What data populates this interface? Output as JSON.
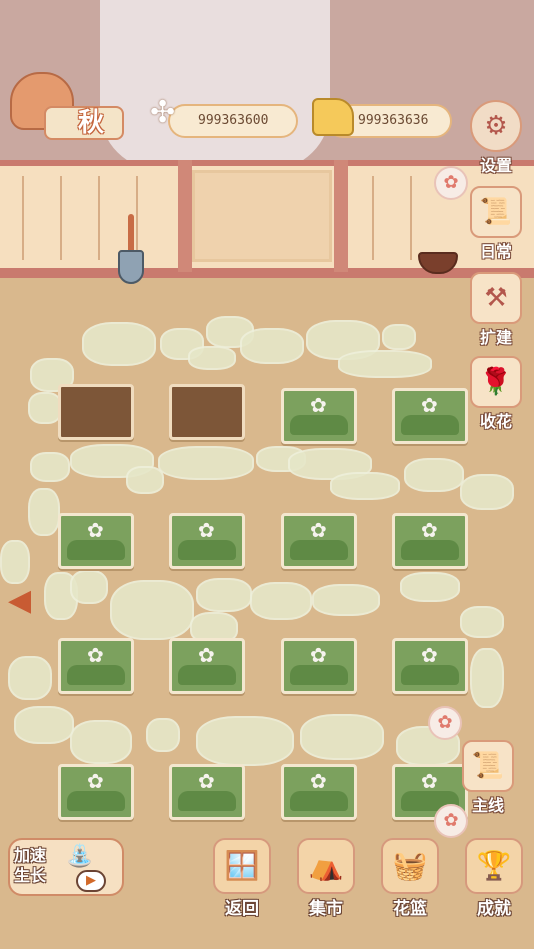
{
  "hud": {
    "season": "秋",
    "season_tree_icon": "autumn-tree-icon",
    "fish_count": "999363600",
    "fish_icon": "fishbone-icon",
    "cheese_count": "999363636",
    "cheese_icon": "cheese-icon"
  },
  "side_menu": {
    "settings": "设置",
    "daily": "日常",
    "expand": "扩建",
    "harvest": "收花",
    "main_quest": "主线"
  },
  "bottom_menu": {
    "speed_up": "加速\n生长",
    "back": "返回",
    "market": "集市",
    "flower_basket": "花篮",
    "achievements": "成就"
  },
  "plots": [
    {
      "state": "empty"
    },
    {
      "state": "empty"
    },
    {
      "state": "grass"
    },
    {
      "state": "grass"
    },
    {
      "state": "grass"
    },
    {
      "state": "grass"
    },
    {
      "state": "grass"
    },
    {
      "state": "grass"
    },
    {
      "state": "grass"
    },
    {
      "state": "grass"
    },
    {
      "state": "grass"
    },
    {
      "state": "grass"
    },
    {
      "state": "grass"
    },
    {
      "state": "grass"
    },
    {
      "state": "grass"
    },
    {
      "state": "grass"
    }
  ],
  "colors": {
    "ground": "#d9b88d",
    "fence": "#f6dfbf",
    "fence_trim": "#c97a6e",
    "grass": "#7ca15e",
    "soil": "#7d5638"
  }
}
